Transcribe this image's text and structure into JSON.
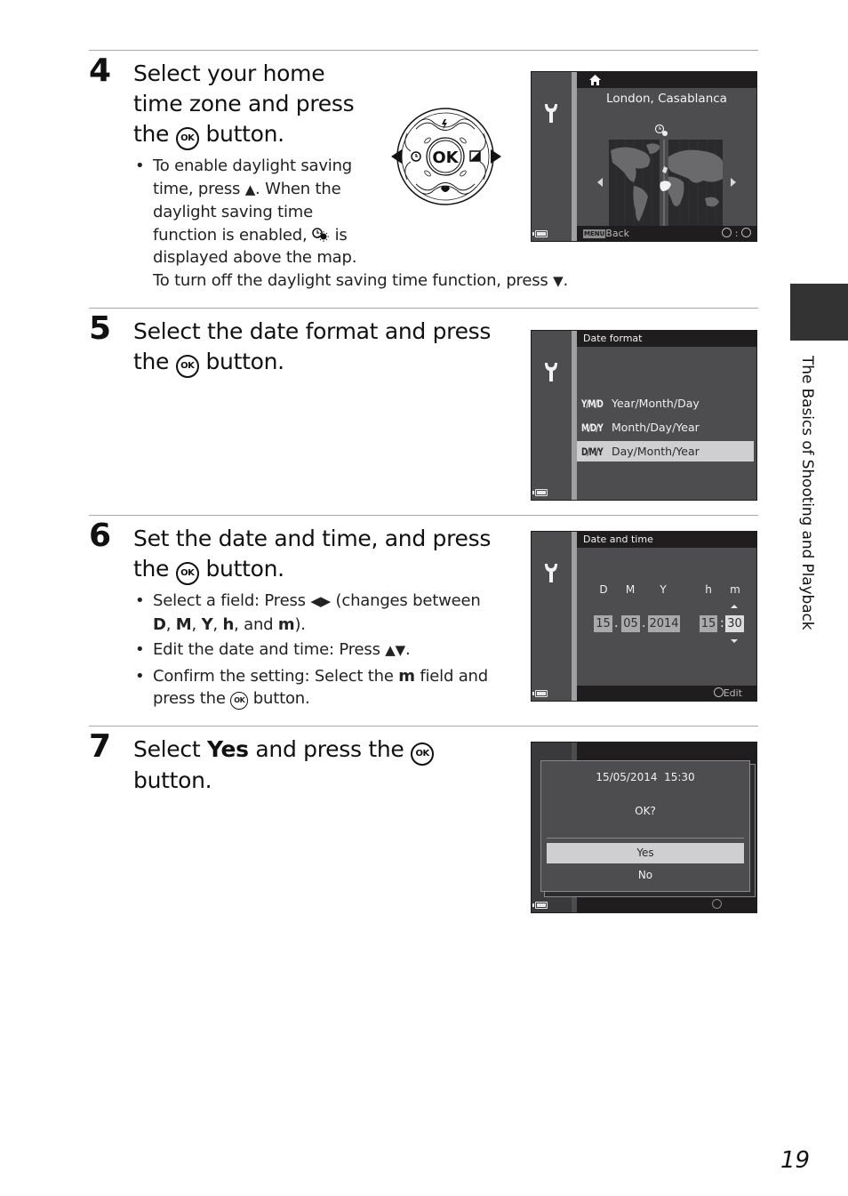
{
  "page": {
    "number": "19",
    "side_tab_label": "The Basics of Shooting and Playback"
  },
  "steps": [
    {
      "number": "4",
      "heading_lines": [
        "Select your home",
        "time zone and press",
        "the",
        "button."
      ],
      "ok_icon": "OK",
      "bullets": [
        {
          "lines": [
            "To enable daylight saving",
            "time, press",
            ". When the",
            "daylight saving time",
            "function is enabled,",
            "is",
            "displayed above the map.",
            "To turn off the daylight saving time function, press",
            "."
          ]
        }
      ],
      "dial": {
        "center_label": "OK",
        "icons": [
          "flash-icon",
          "self-timer-icon",
          "exposure-compensation-icon",
          "macro-icon"
        ]
      },
      "screen": {
        "header_icon": "home-icon",
        "city": "London, Casablanca",
        "dst_icon": "daylight-saving-icon",
        "footer_back": "Back",
        "footer_menu_badge": "MENU",
        "footer_right": ":"
      }
    },
    {
      "number": "5",
      "heading_lines": [
        "Select the date format and press",
        "the",
        "button."
      ],
      "screen": {
        "title": "Date format",
        "options": [
          {
            "code": "Y/M/D",
            "label": "Year/Month/Day",
            "selected": false
          },
          {
            "code": "M/D/Y",
            "label": "Month/Day/Year",
            "selected": false
          },
          {
            "code": "D/M/Y",
            "label": "Day/Month/Year",
            "selected": true
          }
        ]
      }
    },
    {
      "number": "6",
      "heading_lines": [
        "Set the date and time, and press",
        "the",
        "button."
      ],
      "bullets": [
        {
          "text": "Select a field: Press",
          "after": "(changes between",
          "fields": [
            "D",
            "M",
            "Y",
            "h",
            "m"
          ],
          "and": "and",
          "close": ")."
        },
        {
          "text": "Edit the date and time: Press",
          "after": "."
        },
        {
          "text": "Confirm the setting: Select the",
          "bold": "m",
          "after": "field and",
          "line2": "press the",
          "line2_after": "button."
        }
      ],
      "screen": {
        "title": "Date and time",
        "field_labels": [
          "D",
          "M",
          "Y",
          "h",
          "m"
        ],
        "values": {
          "day": "15",
          "month": "05",
          "year": "2014",
          "hour": "15",
          "minute": "30"
        },
        "date_sep": ".",
        "time_sep": ":",
        "active_field": "m",
        "footer": "Edit"
      }
    },
    {
      "number": "7",
      "heading_pre": "Select",
      "heading_bold": "Yes",
      "heading_post": "and press the",
      "heading_line2": "button.",
      "screen": {
        "datetime": "15/05/2014  15:30",
        "question": "OK?",
        "options": [
          {
            "label": "Yes",
            "selected": true
          },
          {
            "label": "No",
            "selected": false
          }
        ]
      }
    }
  ]
}
